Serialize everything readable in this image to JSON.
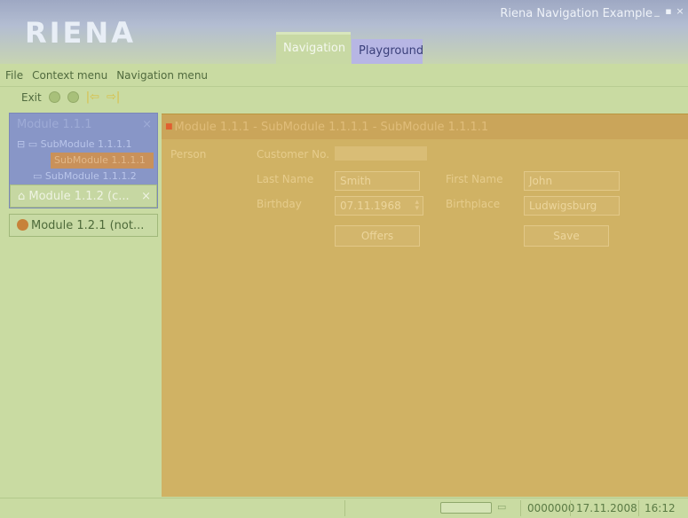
{
  "app": {
    "logo_text": "RIENA",
    "window_title": "Riena Navigation Example",
    "window_controls": [
      "minimize-icon",
      "maximize-icon",
      "close-icon"
    ]
  },
  "top_tabs": [
    {
      "label": "Navigation",
      "active": true
    },
    {
      "label": "Playground",
      "active": false
    }
  ],
  "menu": {
    "file": "File",
    "context_menu": "Context menu",
    "navigation_menu": "Navigation menu"
  },
  "toolbar": {
    "exit_label": "Exit",
    "icons": [
      "circle-icon",
      "circle-icon",
      "back-arrow-icon",
      "forward-arrow-icon"
    ]
  },
  "navigation": {
    "module_111": {
      "label": "Module 1.1.1",
      "close": "×"
    },
    "tree": [
      {
        "label": "SubModule 1.1.1.1",
        "expanded": true
      },
      {
        "label": "SubModule 1.1.1.1",
        "selected": true
      },
      {
        "label": "SubModule 1.1.1.2"
      }
    ],
    "module_112": {
      "label": "Module 1.1.2 (c...",
      "close": "×"
    },
    "module_121": {
      "label": "Module 1.2.1 (not..."
    }
  },
  "content": {
    "title": "Module 1.1.1 - SubModule 1.1.1.1 - SubModule 1.1.1.1",
    "section_label": "Person",
    "customer_no_label": "Customer No.",
    "customer_no_value": "",
    "last_name_label": "Last Name",
    "last_name_value": "Smith",
    "first_name_label": "First Name",
    "first_name_value": "John",
    "birthday_label": "Birthday",
    "birthday_value": "07.11.1968",
    "birthplace_label": "Birthplace",
    "birthplace_value": "Ludwigsburg",
    "offers_button": "Offers",
    "save_button": "Save"
  },
  "statusbar": {
    "number": "0000000",
    "date": "17.11.2008",
    "time": "16:12"
  },
  "colors": {
    "header": "#9ea8c3",
    "background": "#c9dba2",
    "content": "#d0b264",
    "nav_active": "#8896c7",
    "selection": "#c9915a"
  }
}
